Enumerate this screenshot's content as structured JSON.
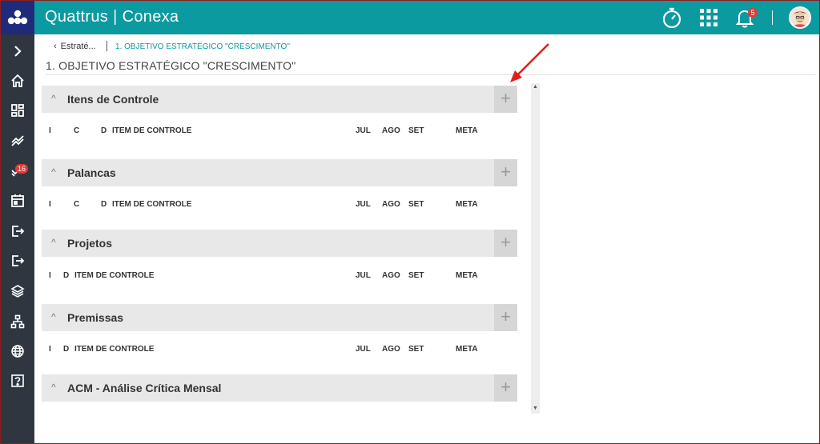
{
  "app": {
    "brand": "Quattrus",
    "product": "Conexa",
    "notifications_count": "5"
  },
  "sidebar": {
    "badge_count": "16",
    "items": [
      {
        "name": "expand",
        "icon": "chevron-right-icon"
      },
      {
        "name": "home",
        "icon": "home-icon"
      },
      {
        "name": "dashboard",
        "icon": "dashboard-grid-icon"
      },
      {
        "name": "indicators",
        "icon": "trend-chart-icon"
      },
      {
        "name": "tasks",
        "icon": "check-list-icon"
      },
      {
        "name": "calendar",
        "icon": "calendar-icon"
      },
      {
        "name": "export",
        "icon": "exit-arrow-icon"
      },
      {
        "name": "export-2",
        "icon": "exit-arrow-icon"
      },
      {
        "name": "layers",
        "icon": "layers-icon"
      },
      {
        "name": "hierarchy",
        "icon": "hierarchy-icon"
      },
      {
        "name": "web",
        "icon": "globe-icon"
      },
      {
        "name": "help",
        "icon": "help-icon"
      }
    ]
  },
  "breadcrumb": {
    "back": "Estraté...",
    "current": "1. OBJETIVO ESTRATÉGICO \"CRESCIMENTO\""
  },
  "page": {
    "title": "1. OBJETIVO ESTRATÉGICO \"CRESCIMENTO\""
  },
  "panels": [
    {
      "title": "Itens de Controle",
      "columns": {
        "c1": "I",
        "c2": "C",
        "c3": "D",
        "item": "ITEM DE CONTROLE",
        "m1": "JUL",
        "m2": "AGO",
        "m3": "SET",
        "meta": "META"
      }
    },
    {
      "title": "Palancas",
      "columns": {
        "c1": "I",
        "c2": "C",
        "c3": "D",
        "item": "ITEM DE CONTROLE",
        "m1": "JUL",
        "m2": "AGO",
        "m3": "SET",
        "meta": "META"
      }
    },
    {
      "title": "Projetos",
      "columns": {
        "c1": "I",
        "c3": "D",
        "item": "ITEM DE CONTROLE",
        "m1": "JUL",
        "m2": "AGO",
        "m3": "SET",
        "meta": "META"
      }
    },
    {
      "title": "Premissas",
      "columns": {
        "c1": "I",
        "c3": "D",
        "item": "ITEM DE CONTROLE",
        "m1": "JUL",
        "m2": "AGO",
        "m3": "SET",
        "meta": "META"
      }
    },
    {
      "title": "ACM - Análise Crítica Mensal"
    }
  ],
  "symbols": {
    "collapse": "^",
    "add": "+",
    "back": "‹",
    "scroll_up": "▲",
    "scroll_down": "▼"
  },
  "colors": {
    "topbar": "#0b9aa0",
    "sidebar": "#2f3640",
    "logo_bg": "#1f2a7a",
    "accent_link": "#0b9aa0",
    "badge": "#e53935",
    "annotation_arrow": "#e0201b"
  }
}
